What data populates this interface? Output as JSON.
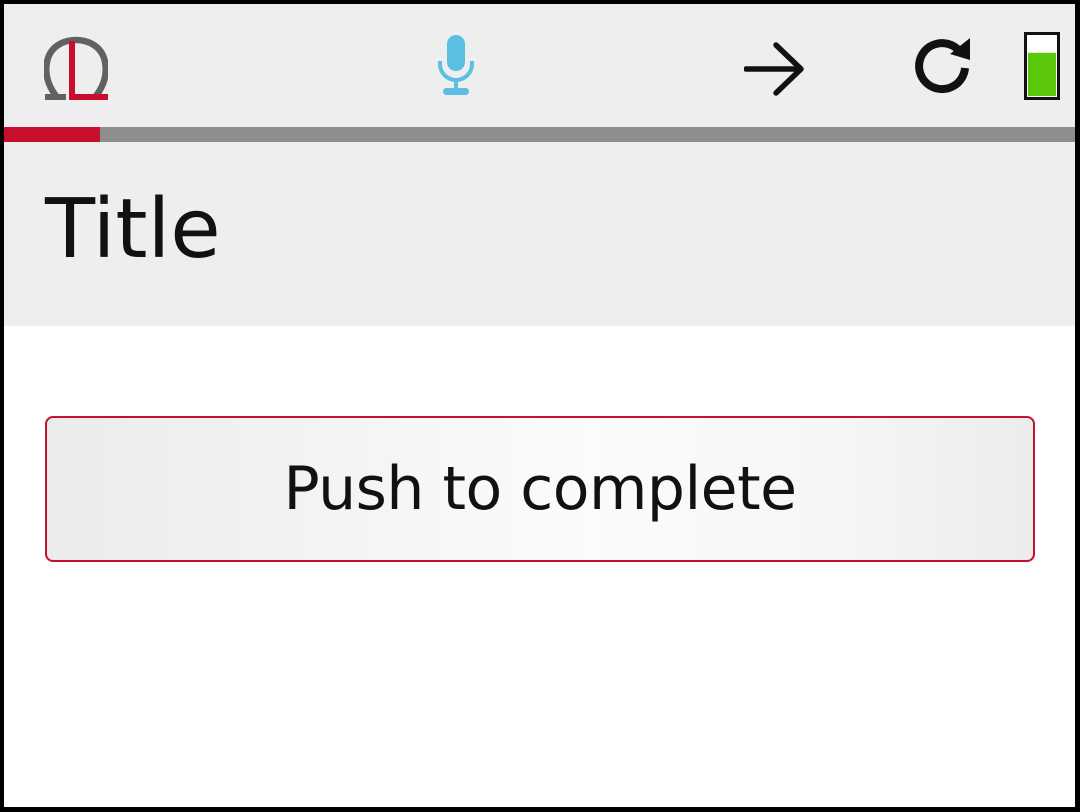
{
  "header": {
    "icons": {
      "logo": "omega-logo-icon",
      "microphone": "microphone-icon",
      "next": "arrow-right-icon",
      "refresh": "refresh-icon",
      "battery": "battery-icon"
    },
    "battery_level": 0.72,
    "colors": {
      "background": "#eeeeee",
      "logo_gray": "#5f6360",
      "logo_red": "#c8102e",
      "microphone": "#5bbfe3",
      "battery_fill": "#5ac70a"
    }
  },
  "progress": {
    "value": 0.09,
    "fill_color": "#c8102e",
    "track_color": "#8e8e8e"
  },
  "page": {
    "title": "Title"
  },
  "actions": {
    "complete_label": "Push to complete",
    "border_color": "#c8102e"
  }
}
